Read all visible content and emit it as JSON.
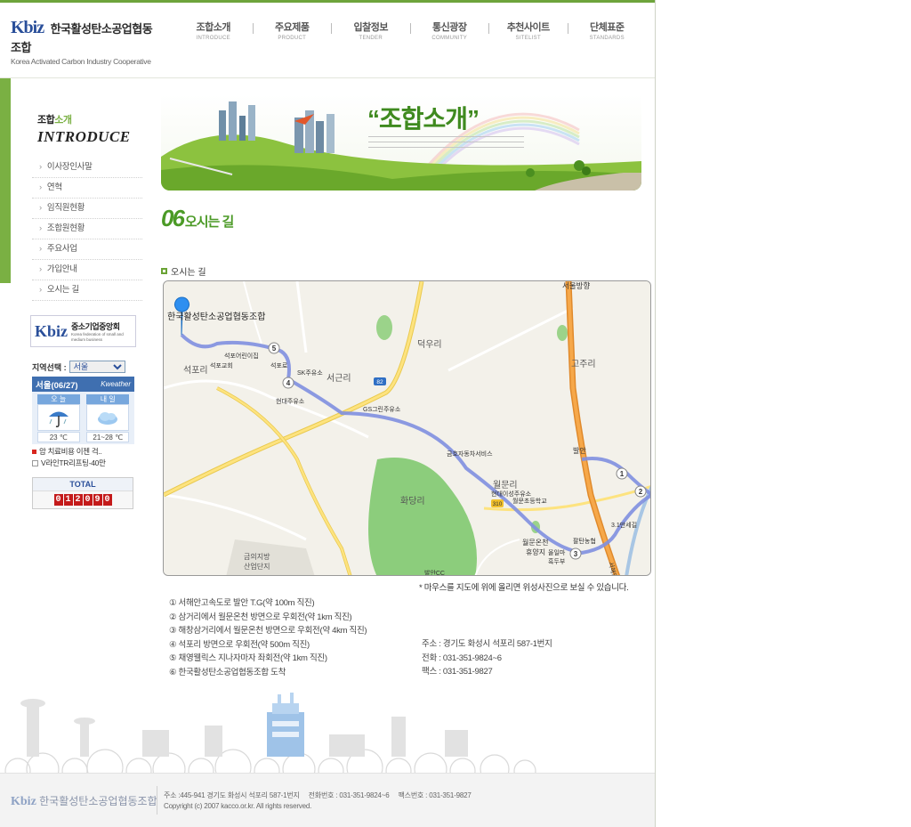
{
  "header": {
    "logo_mark": "Kbiz",
    "logo_name": "한국활성탄소공업협동조합",
    "logo_sub": "Korea Activated Carbon Industry Cooperative",
    "nav": [
      {
        "ko": "조합소개",
        "en": "INTRODUCE"
      },
      {
        "ko": "주요제품",
        "en": "PRODUCT"
      },
      {
        "ko": "입찰정보",
        "en": "TENDER"
      },
      {
        "ko": "통신광장",
        "en": "COMMUNITY"
      },
      {
        "ko": "추천사이트",
        "en": "SITELIST"
      },
      {
        "ko": "단체표준",
        "en": "STANDARDS"
      }
    ]
  },
  "sidebar": {
    "title_a": "조합",
    "title_b": "소개",
    "title_en": "INTRODUCE",
    "menu": [
      "이사장인사말",
      "연혁",
      "임직원현황",
      "조합원현황",
      "주요사업",
      "가입안내",
      "오시는 길"
    ],
    "banner": {
      "mark": "Kbiz",
      "name": "중소기업중앙회",
      "sub": "Korea federation of small and medium business"
    },
    "weather": {
      "region_label": "지역선택 :",
      "region_value": "서울",
      "city_date": "서울(06/27)",
      "brand": "Kweather",
      "today_label": "오 늘",
      "tomorrow_label": "내 일",
      "today_temp": "23 ℃",
      "tomorrow_temp": "21~28 ℃",
      "news1": "암 치료비용 이젠 걱..",
      "news2": "V라인TR리프팅-40만"
    },
    "counter": {
      "label": "TOTAL",
      "digits": [
        "0",
        "1",
        "2",
        "0",
        "9",
        "0"
      ]
    }
  },
  "main": {
    "hero_title": "“조합소개”",
    "page_num": "06",
    "page_title": "오시는 길",
    "section_title": "오시는 길",
    "map": {
      "origin_label": "한국활성탄소공업협동조합",
      "places": {
        "seoul": "서울방향",
        "deokuri": "덕우리",
        "gojuri": "고주리",
        "seopori": "석포리",
        "seogeunri": "서근리",
        "wolmunri": "월문리",
        "hwadangri": "화당리",
        "bangan": "발안",
        "industrial1": "금의지방",
        "industrial2": "산업단지",
        "seopo_daycare": "석포어린이집",
        "seopo_church": "석포교회",
        "seopo_ro": "석포로",
        "sk_gas": "SK주유소",
        "hyundai_gas": "현대주유소",
        "gs_gas": "GS그린주유소",
        "kumho": "금호자동차서비스",
        "hyundai_oil": "현대이성주유소",
        "wolmun_school": "월문초등학교",
        "spa1": "월문온천",
        "spa2": "휴양지",
        "paldan": "팔탄농협",
        "dam": "올일마",
        "dam2": "흑두부",
        "sam1": "3.1만세길",
        "expressway": "서해안고속",
        "road_no": "82",
        "road_no2": "310",
        "bangan_cc": "발안CC"
      },
      "waypoints": [
        "1",
        "2",
        "3",
        "4",
        "5"
      ]
    },
    "map_note": "* 마우스를 지도에 위에 올리면 위성사진으로 보실 수 있습니다.",
    "directions": [
      "① 서해안고속도로 발안 T.G(약 100m 직진)",
      "② 삼거리에서 월문온천 방면으로 우회전(약 1km 직진)",
      "③ 해창삼거리에서 월문온천 방면으로 우회전(약 4km 직진)",
      "④ 석포리 방면으로 우회전(약 500m 직진)",
      "⑤ 채영웰릭스 지나자마자 좌회전(약 1km 직진)",
      "⑥ 한국활성탄소공업협동조합 도착"
    ],
    "contact": {
      "address": "주소 : 경기도 화성시 석포리 587-1번지",
      "phone": "전화 : 031-351-9824~6",
      "fax": "팩스 : 031-351-9827"
    }
  },
  "footer": {
    "logo_mark": "Kbiz",
    "logo_name": "한국활성탄소공업협동조합",
    "address": "주소 :445-941 경기도 화성시 석포리 587-1번지",
    "phone": "전화번호 : 031-351-9824~6",
    "fax": "팩스번호 : 031-351-9827",
    "copyright": "Copyright (c) 2007 kacco.or.kr. All rights reserved."
  },
  "colors": {
    "accent": "#6ea43c",
    "brand": "#2a4f9a",
    "route": "#7f8fe0"
  }
}
